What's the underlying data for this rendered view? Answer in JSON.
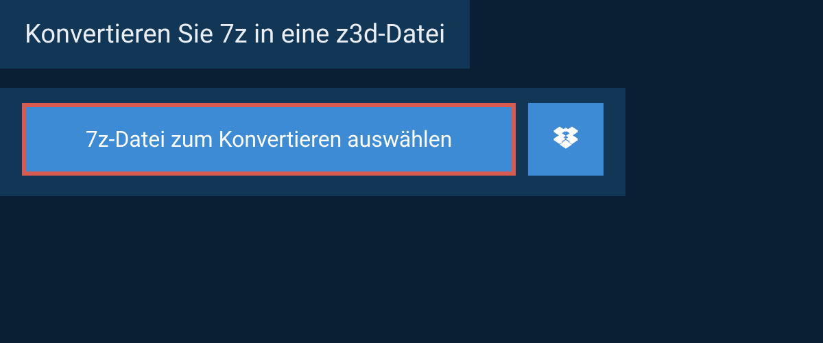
{
  "header": {
    "title": "Konvertieren Sie 7z in eine z3d-Datei"
  },
  "actions": {
    "select_file_label": "7z-Datei zum Konvertieren auswählen",
    "dropbox_icon_name": "dropbox-icon"
  },
  "colors": {
    "background": "#0a1f33",
    "panel": "#123756",
    "button": "#3d8bd4",
    "highlight_border": "#d85a50",
    "text": "#ffffff"
  }
}
